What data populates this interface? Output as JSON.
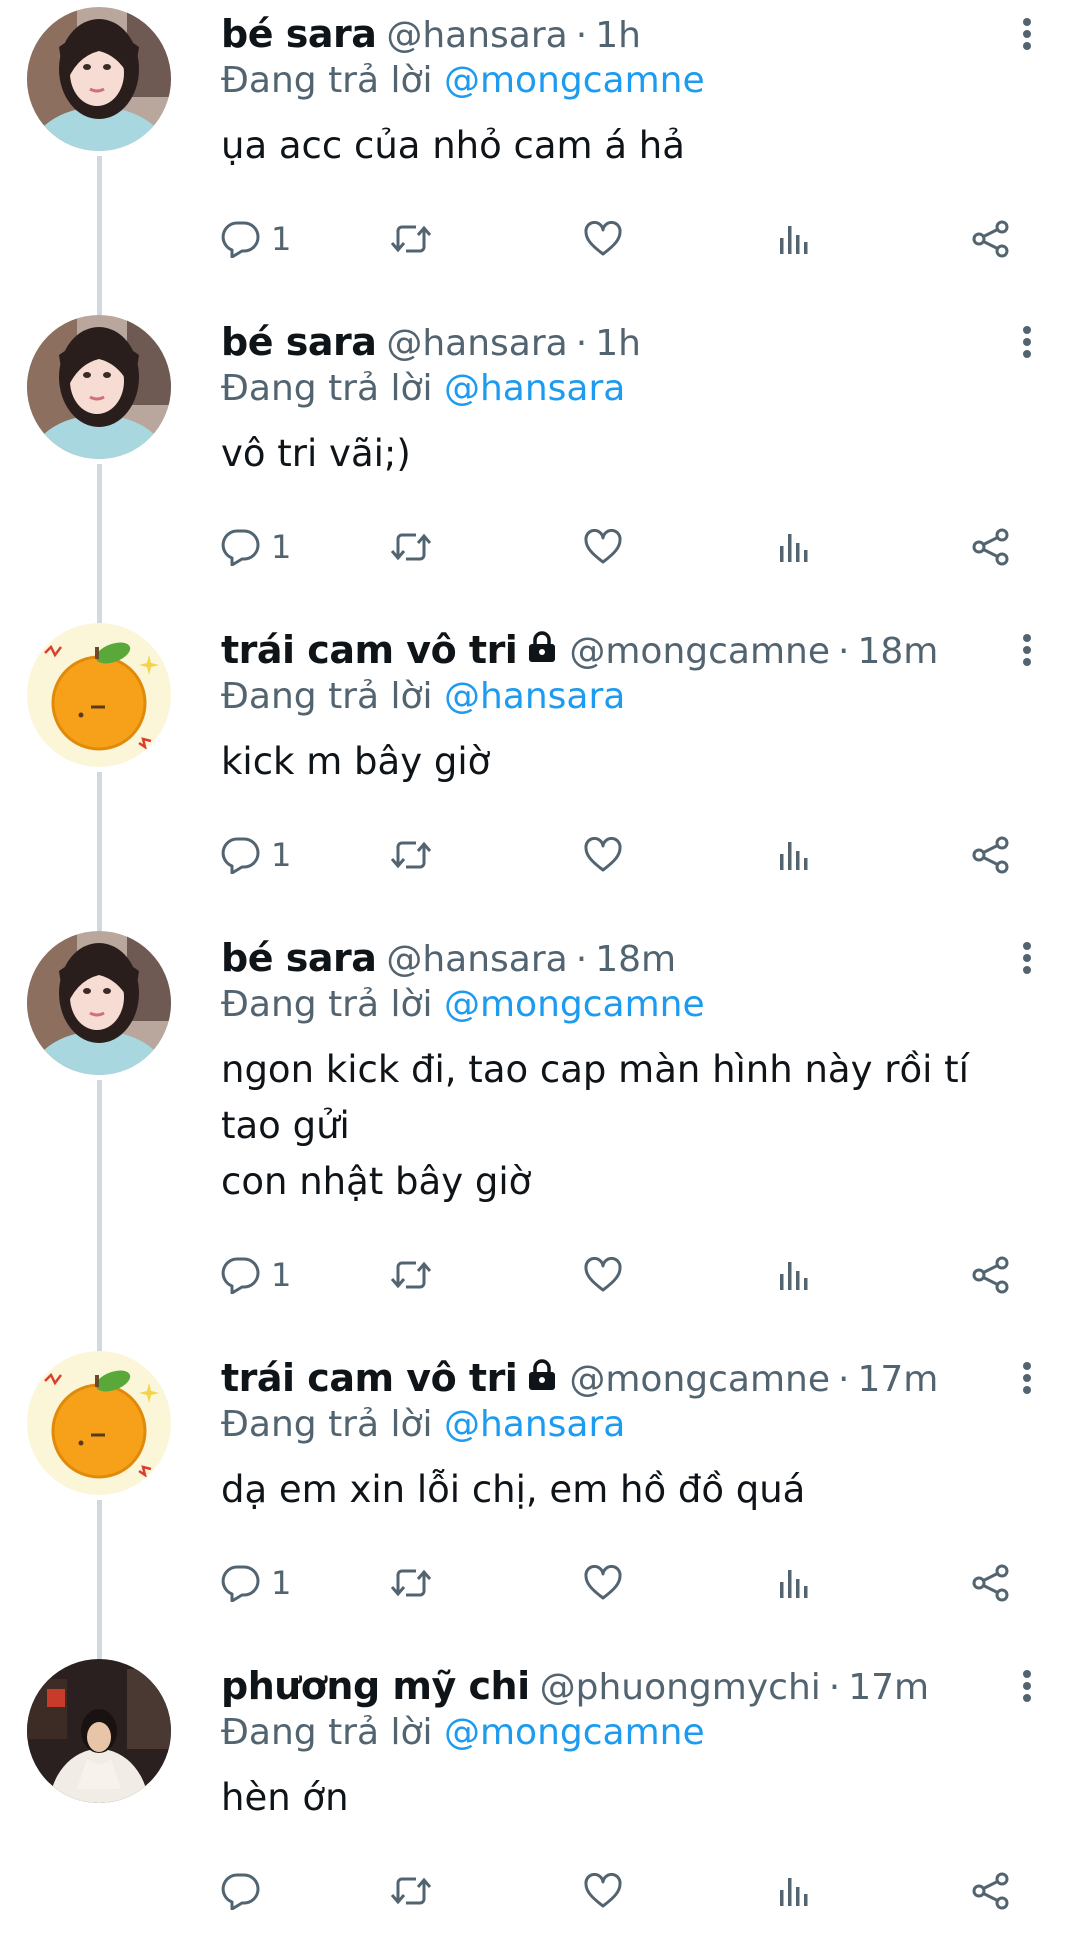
{
  "replying_prefix": "Đang trả lời",
  "colors": {
    "accent": "#1d9bf0",
    "muted": "#536471",
    "thread_line": "#cfd9de"
  },
  "icons": {
    "reply": "reply-icon",
    "retweet": "retweet-icon",
    "like": "heart-icon",
    "views": "views-icon",
    "share": "share-icon",
    "more": "more-vertical-icon",
    "lock": "lock-icon"
  },
  "tweets": [
    {
      "name": "bé sara",
      "locked": false,
      "handle": "@hansara",
      "time": "1h",
      "reply_to": "@mongcamne",
      "text_lines": [
        "ụa acc của nhỏ cam á hả"
      ],
      "reply_count": "1",
      "avatar": "sara-avatar"
    },
    {
      "name": "bé sara",
      "locked": false,
      "handle": "@hansara",
      "time": "1h",
      "reply_to": "@hansara",
      "text_lines": [
        "vô tri vãi;)"
      ],
      "reply_count": "1",
      "avatar": "sara-avatar"
    },
    {
      "name": "trái cam vô tri",
      "locked": true,
      "handle": "@mongcamne",
      "time": "18m",
      "reply_to": "@hansara",
      "text_lines": [
        "kick m bây giờ"
      ],
      "reply_count": "1",
      "avatar": "orange-avatar"
    },
    {
      "name": "bé sara",
      "locked": false,
      "handle": "@hansara",
      "time": "18m",
      "reply_to": "@mongcamne",
      "text_lines": [
        "ngon kick đi, tao cap màn hình này rồi tí tao gửi",
        "con nhật bây giờ"
      ],
      "reply_count": "1",
      "avatar": "sara-avatar"
    },
    {
      "name": "trái cam vô tri",
      "locked": true,
      "handle": "@mongcamne",
      "time": "17m",
      "reply_to": "@hansara",
      "text_lines": [
        "dạ em xin lỗi chị, em hồ đồ quá"
      ],
      "reply_count": "1",
      "avatar": "orange-avatar"
    },
    {
      "name": "phương mỹ chi",
      "locked": false,
      "handle": "@phuongmychi",
      "time": "17m",
      "reply_to": "@mongcamne",
      "text_lines": [
        "hèn ớn"
      ],
      "reply_count": "",
      "avatar": "chi-avatar"
    }
  ]
}
